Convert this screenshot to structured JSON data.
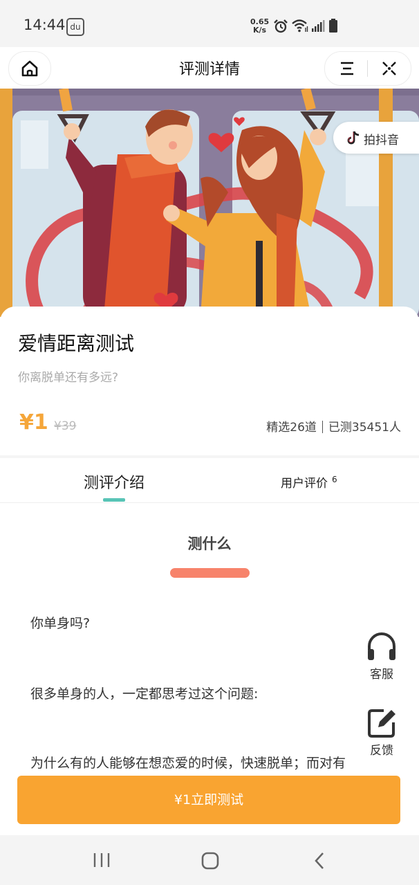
{
  "status_bar": {
    "time": "14:44",
    "net_speed_value": "0.65",
    "net_speed_unit": "K/s",
    "baidu_icon_text": "du"
  },
  "nav": {
    "title": "评测详情"
  },
  "hero": {
    "douyin_label": "拍抖音"
  },
  "test": {
    "title": "爱情距离测试",
    "subtitle": "你离脱单还有多远?",
    "price": "¥1",
    "original_price": "¥39",
    "questions": "精选26道",
    "tested": "已测35451人"
  },
  "tabs": {
    "intro": "测评介绍",
    "reviews": "用户评价",
    "reviews_count": "6"
  },
  "content": {
    "section_title": "测什么",
    "paragraphs": [
      "你单身吗?",
      "很多单身的人，一定都思考过这个问题:",
      "为什么有的人能够在想恋爱的时候，快速脱单；而对有"
    ]
  },
  "floating": {
    "service_label": "客服",
    "feedback_label": "反馈"
  },
  "cta": {
    "label": "¥1立即测试"
  },
  "colors": {
    "accent_orange": "#f9a431",
    "price_orange": "#f5a63a",
    "tab_indicator": "#58c4b6",
    "section_bar": "#f7836b"
  }
}
